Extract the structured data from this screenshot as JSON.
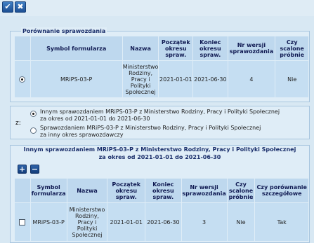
{
  "toolbar": {
    "ok_glyph": "✔",
    "close_glyph": "✖"
  },
  "comparison": {
    "title": "Porównanie sprawozdania",
    "headers": [
      "Symbol formularza",
      "Nazwa",
      "Początek okresu spraw.",
      "Koniec okresu spraw.",
      "Nr wersji sprawozdania",
      "Czy scalone próbnie"
    ],
    "row": [
      "MRiPS-03-P",
      "Ministerstwo Rodziny, Pracy i Polityki Społecznej",
      "2021-01-01",
      "2021-06-30",
      "4",
      "Nie"
    ],
    "row_selected": true
  },
  "compare_with": {
    "label": "z:",
    "option1": "Innym sprawozdaniem MRiPS-03-P z Ministerstwo Rodziny, Pracy i Polityki Społecznej",
    "option1_sub": "za okres od 2021-01-01 do 2021-06-30",
    "option2": "Sprawozdaniem MRiPS-03-P z Ministerstwo Rodziny, Pracy i Polityki Społecznej",
    "option2_sub": "za inny okres sprawozdawczy",
    "selected": 1
  },
  "other": {
    "title_line1": "Innym sprawozdaniem MRiPS-03-P z Ministerstwo Rodziny, Pracy i Polityki Społecznej",
    "title_line2": "za okres od 2021-01-01 do 2021-06-30",
    "add_glyph": "+",
    "remove_glyph": "−",
    "headers": [
      "Symbol formularza",
      "Nazwa",
      "Początek okresu spraw.",
      "Koniec okresu spraw.",
      "Nr wersji sprawozdania",
      "Czy scalone próbnie",
      "Czy porównanie szczegółowe"
    ],
    "row": [
      "MRiPS-03-P",
      "Ministerstwo Rodziny, Pracy i Polityki Społecznej",
      "2021-01-01",
      "2021-06-30",
      "3",
      "Nie",
      "Tak"
    ],
    "row_checked": false
  }
}
